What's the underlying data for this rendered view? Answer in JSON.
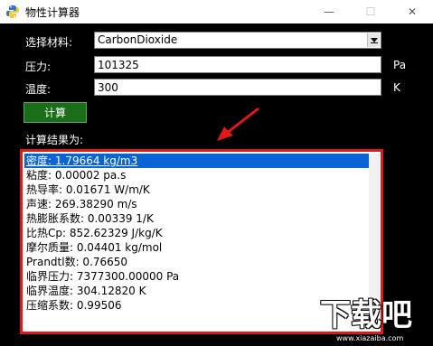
{
  "window": {
    "title": "物性计算器",
    "minimize_glyph": "—",
    "maximize_glyph": "☐",
    "close_glyph": "✕"
  },
  "form": {
    "material_label": "选择材料:",
    "material_value": "CarbonDioxide",
    "pressure_label": "压力:",
    "pressure_value": "101325",
    "pressure_unit": "Pa",
    "temperature_label": "温度:",
    "temperature_value": "300",
    "temperature_unit": "K",
    "calculate_label": "计算",
    "results_label": "计算结果为:"
  },
  "results": [
    "密度: 1.79664 kg/m3",
    "粘度: 0.00002 pa.s",
    "热导率: 0.01671 W/m/K",
    "声速: 269.38290 m/s",
    "热膨胀系数: 0.00339 1/K",
    "比热Cp: 852.62329 J/kg/K",
    "摩尔质量: 0.04401 kg/mol",
    "Prandtl数: 0.76650",
    "临界压力: 7377300.00000 Pa",
    "临界温度: 304.12820 K",
    "压缩系数: 0.99506"
  ],
  "watermark": {
    "logo_text": "下载吧",
    "url": "www.xiazaiba.com"
  },
  "colors": {
    "background": "#000000",
    "button": "#1a6e1a",
    "selection": "#0a64d6",
    "highlight_border": "#e01818"
  }
}
